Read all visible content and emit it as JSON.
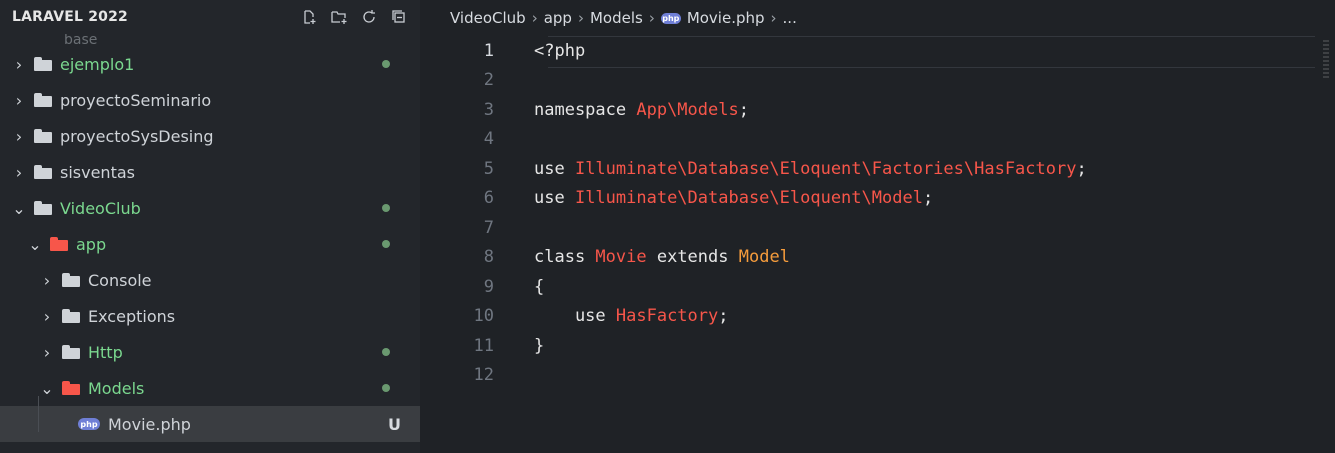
{
  "sidebar": {
    "title": "LARAVEL 2022",
    "actions": [
      "new-file-icon",
      "new-folder-icon",
      "refresh-icon",
      "collapse-all-icon"
    ],
    "truncated_item": "base",
    "items": [
      {
        "label": "ejemplo1",
        "status": "dot"
      },
      {
        "label": "proyectoSeminario"
      },
      {
        "label": "proyectoSysDesing"
      },
      {
        "label": "sisventas"
      },
      {
        "label": "VideoClub",
        "status": "dot"
      },
      {
        "label": "app",
        "status": "dot"
      },
      {
        "label": "Console"
      },
      {
        "label": "Exceptions"
      },
      {
        "label": "Http",
        "status": "dot"
      },
      {
        "label": "Models",
        "status": "dot"
      },
      {
        "label": "Movie.php",
        "status": "U"
      }
    ]
  },
  "editor": {
    "breadcrumb": [
      "VideoClub",
      "app",
      "Models",
      "Movie.php",
      "..."
    ],
    "lines": [
      {
        "n": "1"
      },
      {
        "n": "2"
      },
      {
        "n": "3"
      },
      {
        "n": "4"
      },
      {
        "n": "5"
      },
      {
        "n": "6"
      },
      {
        "n": "7"
      },
      {
        "n": "8"
      },
      {
        "n": "9"
      },
      {
        "n": "10"
      },
      {
        "n": "11"
      },
      {
        "n": "12"
      }
    ],
    "tokens": {
      "l1": "<?php",
      "l3a": "namespace ",
      "l3b": "App\\Models",
      "l3c": ";",
      "l5a": "use ",
      "l5b": "Illuminate\\Database\\Eloquent\\Factories\\HasFactory",
      "l5c": ";",
      "l6a": "use ",
      "l6b": "Illuminate\\Database\\Eloquent\\Model",
      "l6c": ";",
      "l8a": "class ",
      "l8b": "Movie",
      "l8c": " extends ",
      "l8d": "Model",
      "l9": "{",
      "l10a": "    use ",
      "l10b": "HasFactory",
      "l10c": ";",
      "l11": "}"
    }
  },
  "colors": {
    "accent_red": "#f7564a",
    "accent_orange": "#f59c3c",
    "git_dot": "#6a9970",
    "green_text": "#7bd88f"
  }
}
